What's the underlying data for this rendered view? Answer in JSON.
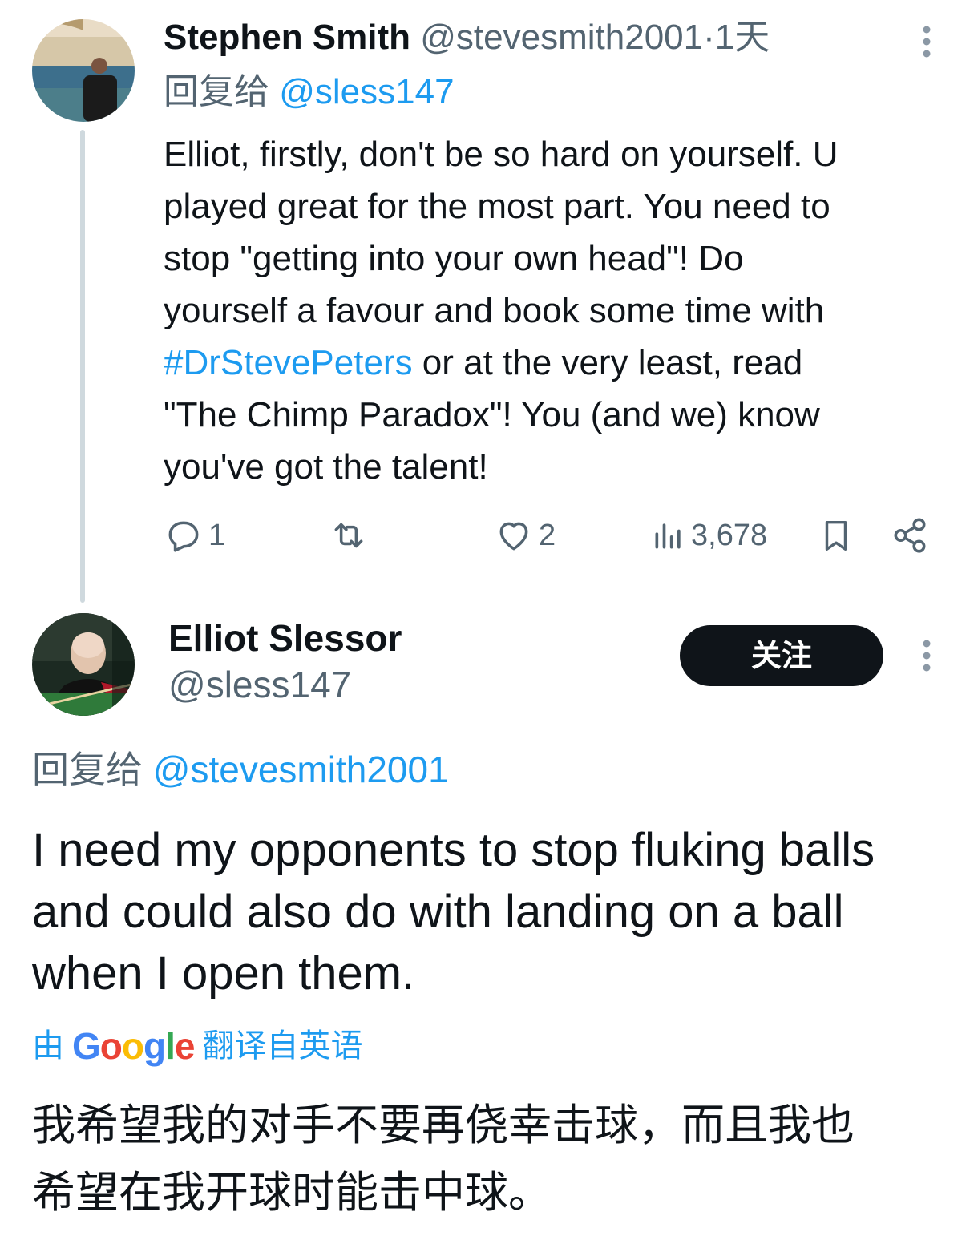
{
  "tweet1": {
    "author_name": "Stephen Smith",
    "author_handle": "@stevesmith2001",
    "separator": "·",
    "time": "1天",
    "reply_prefix": "回复给",
    "reply_to": "@sless147",
    "body_lines": [
      "Elliot, firstly, don't be so hard on yourself. U",
      "played  great for the most part.  You need to",
      "stop \"getting into your own head\"!  Do",
      "yourself a favour and book some time with"
    ],
    "hashtag": "#DrStevePeters",
    "body_after_hashtag": " or at the very least, read",
    "body_tail_lines": [
      "\"The Chimp Paradox\"!  You (and we) know",
      "you've got the talent!"
    ],
    "replies_count": "1",
    "likes_count": "2",
    "views_count": "3,678"
  },
  "tweet2": {
    "author_name": "Elliot Slessor",
    "author_handle": "@sless147",
    "follow_label": "关注",
    "reply_prefix": "回复给",
    "reply_to": "@stevesmith2001",
    "body_lines": [
      "I need my opponents to stop fluking balls",
      "and could also do with landing on a ball",
      "when I open them."
    ],
    "translated_by_prefix": "由",
    "translated_by_brand": "Google",
    "translated_from": "翻译自英语",
    "translation_lines": [
      "我希望我的对手不要再侥幸击球，而且我也",
      "希望在我开球时能击中球。"
    ]
  },
  "icons": {
    "reply": "reply-icon",
    "retweet": "retweet-icon",
    "like": "heart-icon",
    "views": "views-icon",
    "bookmark": "bookmark-icon",
    "share": "share-icon",
    "more": "more-vertical-icon"
  },
  "colors": {
    "link": "#1d9bf0",
    "muted": "#536471",
    "text": "#0f1419",
    "follow_button_bg": "#0f1419"
  }
}
